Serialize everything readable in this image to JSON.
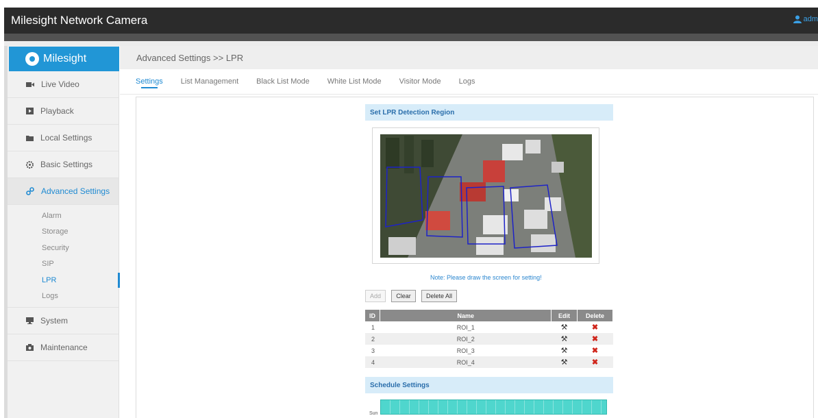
{
  "window": {
    "title": "Milesight Network Camera",
    "user": "adm"
  },
  "brand": {
    "name": "Milesight"
  },
  "sidebar": {
    "items": [
      {
        "label": "Live Video",
        "icon": "video-icon"
      },
      {
        "label": "Playback",
        "icon": "playback-icon"
      },
      {
        "label": "Local Settings",
        "icon": "folder-icon"
      },
      {
        "label": "Basic Settings",
        "icon": "gear-icon"
      },
      {
        "label": "Advanced Settings",
        "icon": "link-icon",
        "active": true
      },
      {
        "label": "System",
        "icon": "monitor-icon"
      },
      {
        "label": "Maintenance",
        "icon": "camera-icon"
      }
    ],
    "sub_items": [
      "Alarm",
      "Storage",
      "Security",
      "SIP",
      "LPR",
      "Logs"
    ],
    "active_sub": "LPR"
  },
  "breadcrumb": "Advanced Settings >> LPR",
  "tabs": [
    "Settings",
    "List Management",
    "Black List Mode",
    "White List Mode",
    "Visitor Mode",
    "Logs"
  ],
  "active_tab": "Settings",
  "detection": {
    "title": "Set LPR Detection Region",
    "note": "Note: Please draw the screen for setting!",
    "buttons": {
      "add": "Add",
      "clear": "Clear",
      "delete_all": "Delete All"
    }
  },
  "roi_table": {
    "headers": [
      "ID",
      "Name",
      "Edit",
      "Delete"
    ],
    "rows": [
      {
        "id": "1",
        "name": "ROI_1"
      },
      {
        "id": "2",
        "name": "ROI_2"
      },
      {
        "id": "3",
        "name": "ROI_3"
      },
      {
        "id": "4",
        "name": "ROI_4"
      }
    ]
  },
  "schedule": {
    "title": "Schedule Settings",
    "day_label": "Sun"
  },
  "colors": {
    "accent": "#1f8ad2",
    "brand": "#2196d6",
    "section": "#d7ecf9",
    "schedule": "#4fd6cd",
    "delete": "#d0261c"
  }
}
